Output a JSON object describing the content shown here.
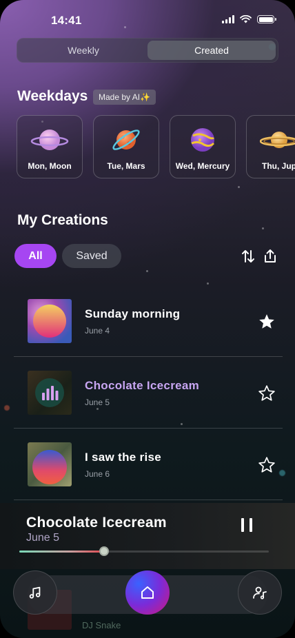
{
  "status_bar": {
    "time": "14:41"
  },
  "segment": {
    "tabs": [
      "Weekly",
      "Created"
    ],
    "active_index": 1
  },
  "weekdays": {
    "title": "Weekdays",
    "badge": "Made by AI✨",
    "items": [
      {
        "label": "Mon, Moon",
        "icon": "moon-planet-icon"
      },
      {
        "label": "Tue, Mars",
        "icon": "mars-planet-icon"
      },
      {
        "label": "Wed, Mercury",
        "icon": "mercury-planet-icon"
      },
      {
        "label": "Thu, Jup",
        "icon": "jupiter-planet-icon"
      }
    ]
  },
  "creations": {
    "title": "My Creations",
    "filters": {
      "all": "All",
      "saved": "Saved"
    },
    "items": [
      {
        "title": "Sunday morning",
        "date": "June 4",
        "saved": true,
        "playing": false
      },
      {
        "title": "Chocolate Icecream",
        "date": "June 5",
        "saved": false,
        "playing": true
      },
      {
        "title": "I saw the rise",
        "date": "June 6",
        "saved": false,
        "playing": false
      }
    ],
    "partial_item": {
      "subtitle": "DJ Snake"
    }
  },
  "now_playing": {
    "title": "Chocolate Icecream",
    "date": "June 5",
    "progress": 0.34,
    "buffered": 0.34
  },
  "colors": {
    "accent": "#a646f2",
    "playing_title": "#c8a6f2",
    "home_gradient": [
      "#3a62ff",
      "#7b2bd8",
      "#d0187c"
    ]
  },
  "nav": {
    "left_icon": "music-note-icon",
    "center_icon": "home-icon",
    "right_icon": "user-music-icon"
  }
}
